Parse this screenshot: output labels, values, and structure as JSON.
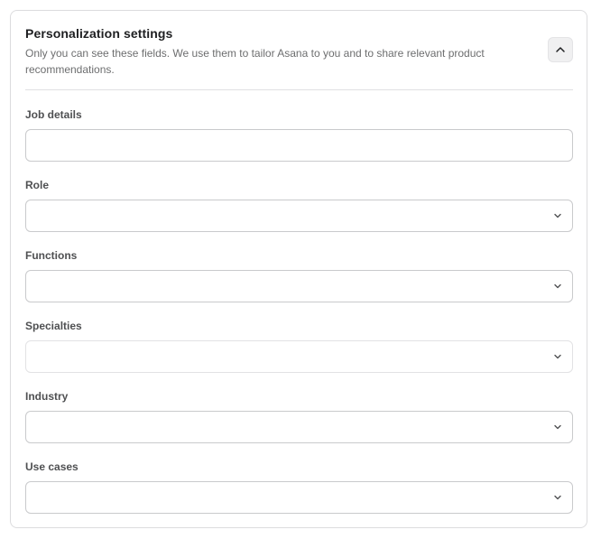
{
  "section": {
    "title": "Personalization settings",
    "description": "Only you can see these fields. We use them to tailor Asana to you and to share relevant product recommendations.",
    "collapse_icon": "chevron-up-icon"
  },
  "fields": {
    "job_details": {
      "label": "Job details",
      "value": ""
    },
    "role": {
      "label": "Role",
      "value": ""
    },
    "functions": {
      "label": "Functions",
      "value": ""
    },
    "specialties": {
      "label": "Specialties",
      "value": ""
    },
    "industry": {
      "label": "Industry",
      "value": ""
    },
    "use_cases": {
      "label": "Use cases",
      "value": ""
    }
  },
  "colors": {
    "text": "#1e1f21",
    "muted": "#6d6e6f",
    "border": "#c9cacc"
  }
}
